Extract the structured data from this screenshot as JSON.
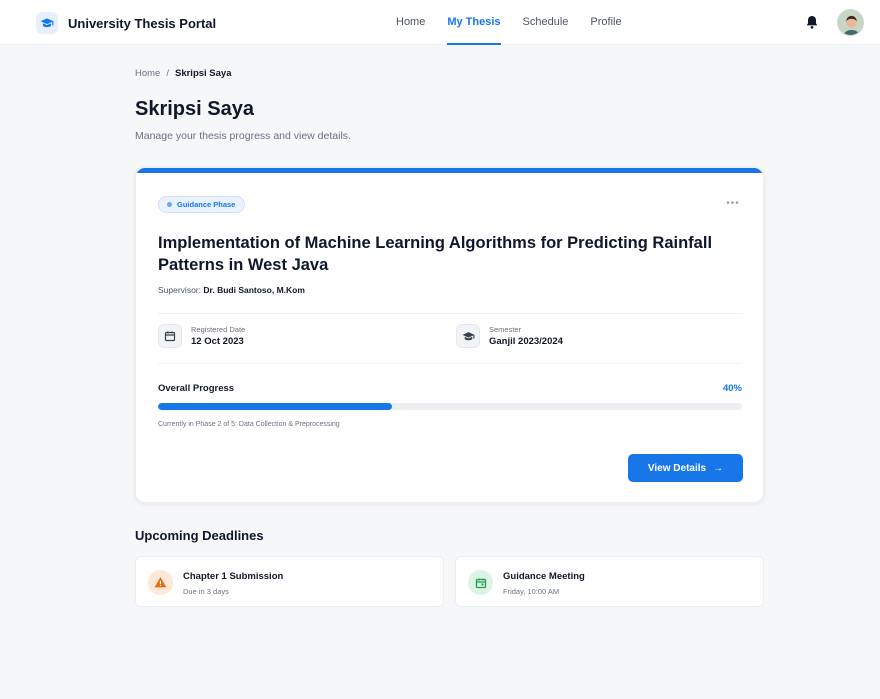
{
  "app": {
    "title": "University Thesis Portal"
  },
  "nav": {
    "items": [
      {
        "label": "Home",
        "active": false
      },
      {
        "label": "My Thesis",
        "active": true
      },
      {
        "label": "Schedule",
        "active": false
      },
      {
        "label": "Profile",
        "active": false
      }
    ]
  },
  "breadcrumb": {
    "home": "Home",
    "separator": "/",
    "current": "Skripsi Saya"
  },
  "page": {
    "title": "Skripsi Saya",
    "subtitle": "Manage your thesis progress and view details."
  },
  "thesis": {
    "phase_badge": "Guidance Phase",
    "more_label": "•••",
    "title": "Implementation of Machine Learning Algorithms for Predicting Rainfall Patterns in West Java",
    "supervisor_label": "Supervisor:",
    "supervisor_name": "Dr. Budi Santoso, M.Kom",
    "registered_label": "Registered Date",
    "registered_value": "12 Oct 2023",
    "semester_label": "Semester",
    "semester_value": "Ganjil 2023/2024",
    "progress_label": "Overall Progress",
    "progress_text": "40%",
    "progress_fraction": 0.4,
    "progress_note": "Currently in Phase 2 of 5: Data Collection & Preprocessing",
    "details_button": "View Details",
    "details_arrow": "→"
  },
  "deadlines": {
    "title": "Upcoming Deadlines",
    "items": [
      {
        "title": "Chapter 1 Submission",
        "subtitle": "Due in 3 days",
        "icon": "warning-icon"
      },
      {
        "title": "Guidance Meeting",
        "subtitle": "Friday, 10:00 AM",
        "icon": "calendar-icon"
      }
    ]
  },
  "colors": {
    "accent": "#1877e8",
    "warning_bg": "#fde8d7",
    "warning": "#ea6c12",
    "success_bg": "#dcf4e4",
    "success": "#1f9d55"
  }
}
